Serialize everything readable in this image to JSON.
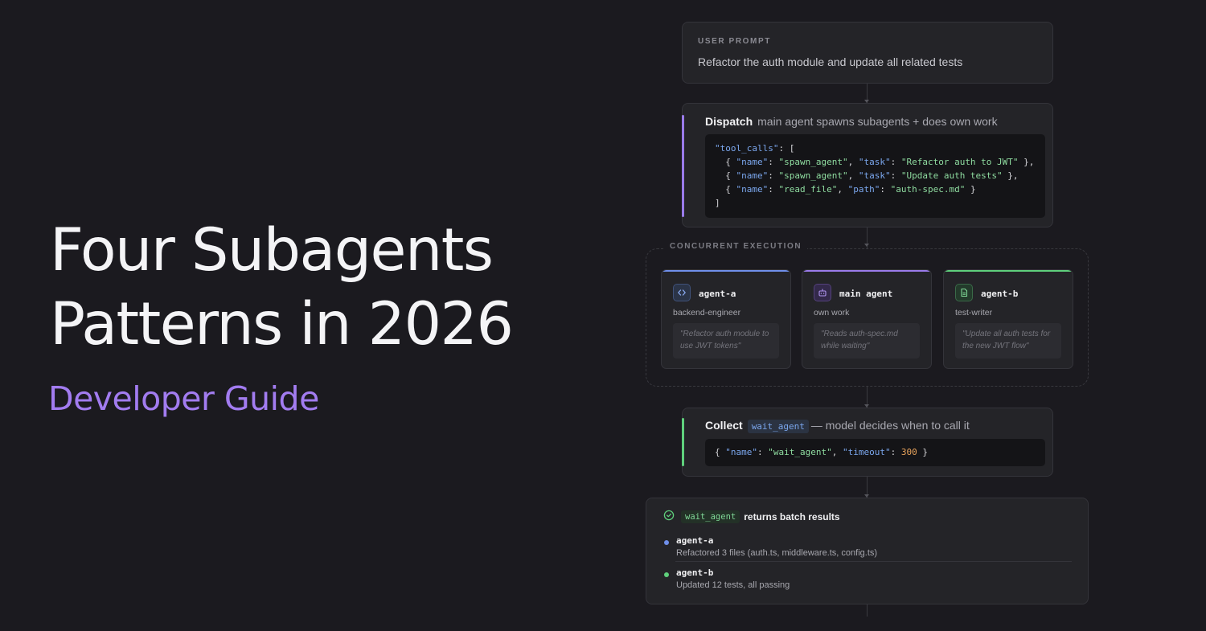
{
  "hero": {
    "title_line1": "Four Subagents",
    "title_line2": "Patterns in 2026",
    "subtitle": "Developer Guide"
  },
  "colors": {
    "background": "#1b1a1f",
    "accent_purple": "#a27cf0",
    "accent_blue": "#6f8fea",
    "accent_green": "#5fd07c"
  },
  "prompt": {
    "label": "USER PROMPT",
    "text": "Refactor the auth module and update all related tests"
  },
  "dispatch": {
    "title": "Dispatch",
    "description": "main agent spawns subagents + does own work"
  },
  "concurrent": {
    "label": "CONCURRENT EXECUTION",
    "agents": [
      {
        "name": "agent-a",
        "role": "backend-engineer",
        "task": "\"Refactor auth module to use JWT tokens\"",
        "icon": "code-icon",
        "color": "#6f8fea"
      },
      {
        "name": "main agent",
        "role": "own work",
        "task": "\"Reads auth-spec.md while waiting\"",
        "icon": "robot-icon",
        "color": "#9a7bea"
      },
      {
        "name": "agent-b",
        "role": "test-writer",
        "task": "\"Update all auth tests for the new JWT flow\"",
        "icon": "file-icon",
        "color": "#5fd07c"
      }
    ]
  },
  "collect": {
    "title": "Collect",
    "tool": "wait_agent",
    "description": "— model decides when to call it"
  },
  "results": {
    "tool": "wait_agent",
    "heading": "returns batch results",
    "items": [
      {
        "name": "agent-a",
        "desc": "Refactored 3 files (auth.ts, middleware.ts, config.ts)",
        "color": "#6f8fea"
      },
      {
        "name": "agent-b",
        "desc": "Updated 12 tests, all passing",
        "color": "#5fd07c"
      }
    ]
  }
}
